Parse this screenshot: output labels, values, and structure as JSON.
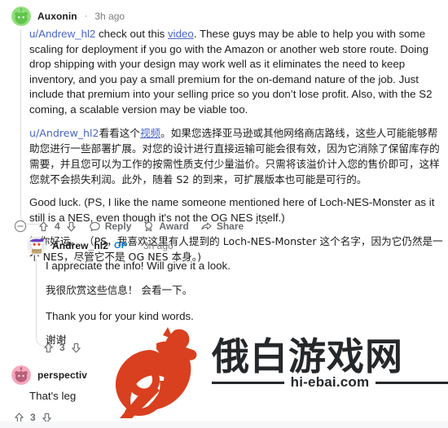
{
  "watermark": {
    "cn_text": "俄白游戏网",
    "url": "hi-ebai.com",
    "rooster_color": "#d9401f",
    "text_color": "#25282b"
  },
  "colors": {
    "link": "#4a66c7",
    "op_badge": "#0079d3",
    "meta_text": "#7c7c7c",
    "action_text": "#6a6d70",
    "body_text": "#1c1c1c",
    "threadline": "#dcdcdc"
  },
  "comments": [
    {
      "username": "Auxonin",
      "separator": "·",
      "timestamp": "3h ago",
      "avatar_name": "avatar-auxonin",
      "paragraphs": [
        {
          "lang": "en",
          "segments": [
            {
              "type": "link",
              "text": "u/Andrew_hl2",
              "underline": false
            },
            {
              "type": "text",
              "text": " check out this "
            },
            {
              "type": "link",
              "text": "video",
              "underline": true
            },
            {
              "type": "text",
              "text": ". These guys may be able to help you with some scaling for deployment if you go with the Amazon or another web store route. Doing drop shipping with your design may work well as it eliminates the need to keep inventory, and you pay a small premium for the on-demand nature of the job. Just include that premium into your selling price so you don’t lose profit. Also, with the S2 coming, a scalable version may be viable too."
            }
          ]
        },
        {
          "lang": "zh",
          "segments": [
            {
              "type": "link",
              "text": "u/Andrew_hl2",
              "underline": false
            },
            {
              "type": "text",
              "text": "看看这个"
            },
            {
              "type": "link",
              "text": "视频",
              "underline": true
            },
            {
              "type": "text",
              "text": "。如果您选择亚马逊或其他网络商店路线，这些人可能能够帮助您进行一些部署扩展。对您的设计进行直接运输可能会很有效，因为它消除了保留库存的需要，并且您可以为工作的按需性质支付少量溢价。只需将该溢价计入您的售价即可，这样您就不会损失利润。此外，随着 S2 的到来，可扩展版本也可能是可行的。"
            }
          ]
        },
        {
          "lang": "en",
          "segments": [
            {
              "type": "text",
              "text": "Good luck. (PS, I like the name someone mentioned here of Loch-NES-Monster as it still is a NES, even though it's not the OG NES itself.)"
            }
          ]
        },
        {
          "lang": "zh",
          "segments": [
            {
              "type": "text",
              "text": "祝你好运。 （PS，我喜欢这里有人提到的 Loch-NES-Monster 这个名字，因为它仍然是一个 NES，尽管它不是 OG NES 本身。)"
            }
          ]
        }
      ],
      "actions": {
        "collapse_icon": "circle-minus-icon",
        "upvote_icon": "upvote-arrow-icon",
        "downvote_icon": "downvote-arrow-icon",
        "vote_count": "4",
        "reply_label": "Reply",
        "reply_icon": "comment-bubble-icon",
        "award_label": "Award",
        "award_icon": "award-badge-icon",
        "share_label": "Share",
        "share_icon": "share-arrow-icon",
        "more_label": "···"
      }
    },
    {
      "username": "Andrew_hl2",
      "op_label": "OP",
      "separator": "·",
      "timestamp": "3h ago",
      "avatar_name": "avatar-andrew-hl2",
      "paragraphs": [
        {
          "lang": "en",
          "text": "I appreciate the info! Will give it a look."
        },
        {
          "lang": "zh",
          "text": "我很欣赏这些信息！ 会看一下。"
        },
        {
          "lang": "en",
          "text": "Thank you for your kind words."
        },
        {
          "lang": "zh",
          "text": "谢谢"
        }
      ],
      "actions": {
        "upvote_icon": "upvote-arrow-icon",
        "downvote_icon": "downvote-arrow-icon",
        "vote_count": "3"
      }
    },
    {
      "username": "perspectiv",
      "avatar_name": "avatar-perspectiv",
      "paragraphs": [
        {
          "lang": "en",
          "text": "That's leg"
        }
      ],
      "actions": {
        "upvote_icon": "upvote-arrow-icon",
        "downvote_icon": "downvote-arrow-icon",
        "vote_count": "3"
      }
    }
  ]
}
